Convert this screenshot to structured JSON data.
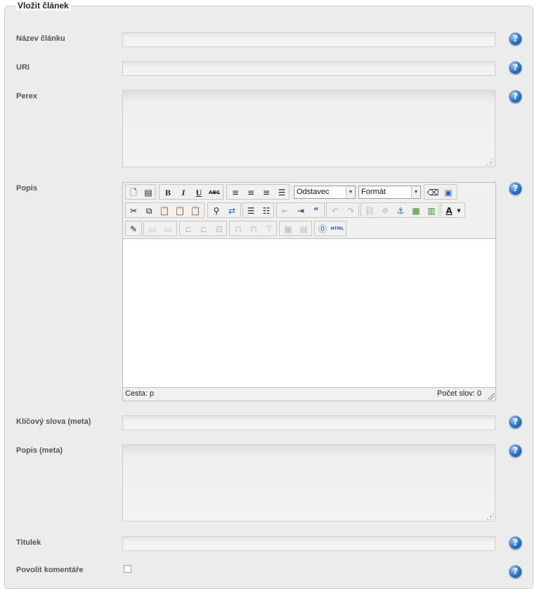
{
  "form": {
    "legend": "Vložit článek",
    "fields": {
      "title_label": "Název článku",
      "uri_label": "URI",
      "perex_label": "Perex",
      "popis_label": "Popis",
      "keywords_label": "Klíčový slova (meta)",
      "meta_desc_label": "Popis (meta)",
      "titulek_label": "Titulek",
      "cut_label": "Povolit komentáře"
    },
    "help_glyph": "?"
  },
  "editor": {
    "block_format": "Odstavec",
    "format_select": "Formát",
    "status_path": "Cesta: p",
    "word_count": "Počet slov: 0",
    "buttons": {
      "bold": "B",
      "italic": "I",
      "underline": "U",
      "strike": "ABC",
      "quote": "“",
      "font_color": "A",
      "html": "HTML"
    }
  },
  "colors": {
    "panel": "#ececec",
    "help_blue": "#2a6fc4"
  }
}
